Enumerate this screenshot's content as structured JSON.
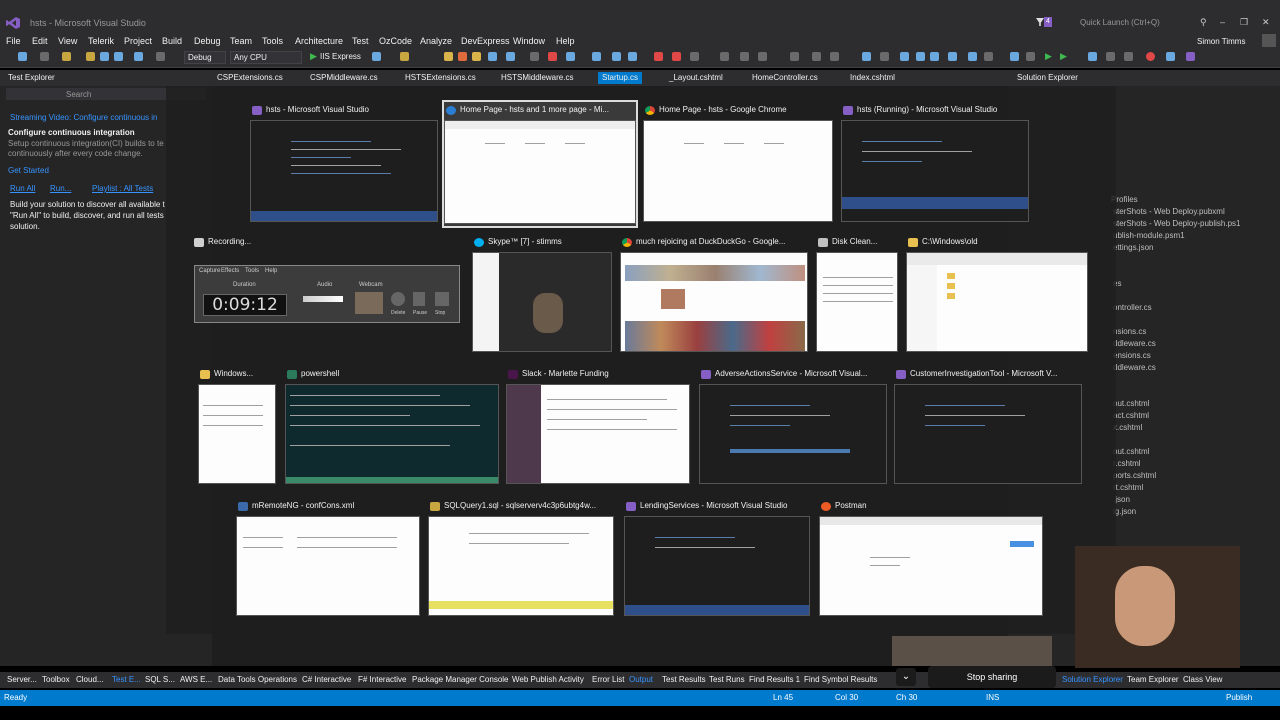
{
  "window": {
    "title": "hsts - Microsoft Visual Studio",
    "quick_launch": "Quick Launch (Ctrl+Q)",
    "user": "Simon Timms",
    "notifications": "4"
  },
  "menu": [
    "File",
    "Edit",
    "View",
    "Telerik",
    "Project",
    "Build",
    "Debug",
    "Team",
    "Tools",
    "Architecture",
    "Test",
    "OzCode",
    "Analyze",
    "DevExpress",
    "Window",
    "Help"
  ],
  "toolbar": {
    "config": "Debug",
    "platform": "Any CPU",
    "run_target": "IIS Express"
  },
  "doc_tabs": [
    "CSPExtensions.cs",
    "CSPMiddleware.cs",
    "HSTSExtensions.cs",
    "HSTSMiddleware.cs",
    "Startup.cs",
    "_Layout.cshtml",
    "HomeController.cs",
    "Index.cshtml"
  ],
  "active_tab": "Startup.cs",
  "left_panel": {
    "title": "Test Explorer",
    "search_placeholder": "Search",
    "streaming": "Streaming Video: Configure continuous in",
    "ci_heading": "Configure continuous integration",
    "ci_text_1": "Setup continuous integration(CI) builds to te",
    "ci_text_2": "continuously after every code change.",
    "get_started": "Get Started",
    "run_all": "Run All",
    "run": "Run...",
    "playlist": "Playlist : All Tests",
    "hint_1": "Build your solution to discover all available t",
    "hint_2": "\"Run All\" to build, discover, and run all tests",
    "hint_3": "solution."
  },
  "right_panel": {
    "title": "Solution Explorer",
    "items": [
      "Profiles",
      "sterShots - Web Deploy.pubxml",
      "sterShots - Web Deploy-publish.ps1",
      "ublish-module.psm1",
      "ettings.json",
      "es",
      "ontroller.cs",
      "nsions.cs",
      "ddleware.cs",
      "ensions.cs",
      "ddleware.cs",
      "out.cshtml",
      "act.cshtml",
      "x.cshtml",
      "out.cshtml",
      "r.cshtml",
      "ports.cshtml",
      "rt.cshtml",
      ".json",
      "ig.json"
    ]
  },
  "switcher": {
    "row1": [
      {
        "title": "hsts - Microsoft Visual Studio",
        "icon": "vs-icon"
      },
      {
        "title": "Home Page - hsts and 1 more page - Mi...",
        "icon": "edge-icon"
      },
      {
        "title": "Home Page - hsts - Google Chrome",
        "icon": "chrome-icon"
      },
      {
        "title": "hsts (Running) - Microsoft Visual Studio",
        "icon": "vs-icon"
      }
    ],
    "row2": [
      {
        "title": "Recording...",
        "icon": "recorder-icon"
      },
      {
        "title": "Skype™ [7] - stimms",
        "icon": "skype-icon"
      },
      {
        "title": "much rejoicing at DuckDuckGo - Google...",
        "icon": "chrome-icon"
      },
      {
        "title": "Disk Clean...",
        "icon": "disk-icon"
      },
      {
        "title": "C:\\Windows\\old",
        "icon": "folder-icon"
      }
    ],
    "row3": [
      {
        "title": "Windows...",
        "icon": "folder-icon"
      },
      {
        "title": "powershell",
        "icon": "conemu-icon"
      },
      {
        "title": "Slack - Marlette Funding",
        "icon": "slack-icon"
      },
      {
        "title": "AdverseActionsService - Microsoft Visual...",
        "icon": "vs-icon"
      },
      {
        "title": "CustomerInvestigationTool - Microsoft V...",
        "icon": "vs-icon"
      }
    ],
    "row4": [
      {
        "title": "mRemoteNG - confCons.xml",
        "icon": "mremote-icon"
      },
      {
        "title": "SQLQuery1.sql - sqlserverv4c3p6ubtg4w...",
        "icon": "sql-icon"
      },
      {
        "title": "LendingServices - Microsoft Visual Studio",
        "icon": "vs-icon"
      },
      {
        "title": "Postman",
        "icon": "postman-icon"
      }
    ],
    "recorder": {
      "duration_label": "Duration",
      "audio_label": "Audio",
      "webcam_label": "Webcam",
      "time": "0:09:12",
      "tabs": [
        "Capture",
        "Effects",
        "Tools",
        "Help"
      ],
      "buttons": [
        "Delete",
        "Pause",
        "Stop"
      ]
    }
  },
  "bottom_tabs": [
    "Server...",
    "Toolbox",
    "Cloud...",
    "Test E...",
    "SQL S...",
    "AWS E...",
    "Data Tools Operations",
    "C# Interactive",
    "F# Interactive",
    "Package Manager Console",
    "Web Publish Activity",
    "Error List",
    "Output",
    "Test Results",
    "Test Runs",
    "Find Results 1",
    "Find Symbol Results"
  ],
  "bottom_right_tabs": [
    "Solution Explorer",
    "Team Explorer",
    "Class View"
  ],
  "sharing": {
    "stop_label": "Stop sharing"
  },
  "status": {
    "ready": "Ready",
    "ln": "Ln 45",
    "col": "Col 30",
    "ch": "Ch 30",
    "ins": "INS",
    "publish": "Publish"
  },
  "colors": {
    "accent": "#007acc",
    "chrome_bg": "#2d2d30",
    "panel_bg": "#252526",
    "vs_purple": "#865fc5"
  }
}
